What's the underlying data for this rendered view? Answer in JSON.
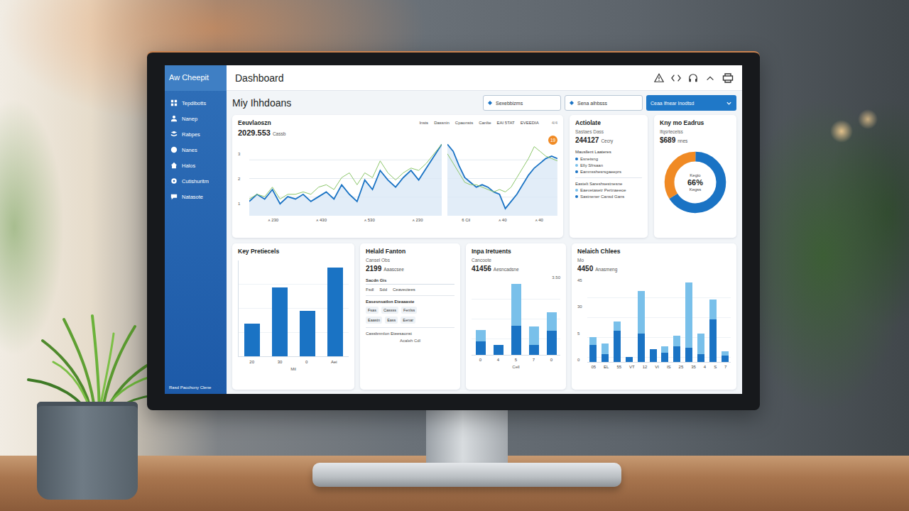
{
  "sidebar": {
    "brand": "Aw Cheepit",
    "items": [
      "Tepdlbotts",
      "Nanep",
      "Rabpes",
      "Nanes",
      "Halos",
      "Cutishuritm",
      "Natasote"
    ],
    "footer": "Rasd Pacchony Clene"
  },
  "topbar": {
    "title": "Dashboard"
  },
  "header": {
    "heading": "Miy Ihhdoans",
    "filters": [
      "Sexebbizms",
      "Sena alhbsss"
    ],
    "dropdown": "Ceaa Ifnear Inodtsd"
  },
  "trend": {
    "title": "Eeuvlaoszn",
    "tabs": [
      "Insts",
      "Dassnin",
      "Cpaonsts",
      "Canlte",
      "EAI 5TAT",
      "EVEEDIA"
    ],
    "corner": "4/4",
    "value": "2029.553",
    "unit": "Cassb",
    "y_ticks": [
      "3",
      "2",
      "1"
    ],
    "badge": "19",
    "charts": [
      {
        "x_labels": [
          "ᴀ 230",
          "ᴀ 430",
          "ᴀ 530",
          "ᴀ 230"
        ],
        "series": [
          {
            "values": [
              0.6,
              0.9,
              0.7,
              1.1,
              0.5,
              0.8,
              0.7,
              0.9,
              0.6,
              0.8,
              1.0,
              0.7,
              1.3,
              0.9,
              0.6,
              1.5,
              1.1,
              1.9,
              1.5,
              1.2,
              1.6,
              1.9,
              1.5,
              2.0,
              2.5,
              3.0
            ],
            "color": "#1a73c4"
          },
          {
            "values": [
              0.7,
              0.9,
              0.8,
              1.2,
              0.7,
              0.9,
              0.9,
              1.0,
              0.9,
              1.2,
              1.3,
              1.1,
              1.6,
              1.8,
              1.3,
              1.8,
              1.6,
              2.3,
              1.8,
              1.5,
              1.8,
              2.0,
              1.9,
              2.2,
              2.6,
              3.0
            ],
            "color": "#8cc66a"
          }
        ]
      },
      {
        "x_labels": [
          "6 Cil",
          "ᴀ 40",
          "ᴀ 40"
        ],
        "series": [
          {
            "values": [
              3.0,
              2.7,
              2.1,
              1.6,
              1.4,
              1.2,
              1.3,
              1.2,
              1.0,
              0.9,
              0.3,
              0.6,
              0.9,
              1.3,
              1.7,
              2.0,
              2.2,
              2.4,
              2.5,
              2.4
            ],
            "color": "#1a73c4"
          },
          {
            "values": [
              2.6,
              2.2,
              1.8,
              1.4,
              1.3,
              1.3,
              1.2,
              1.1,
              1.0,
              1.1,
              1.0,
              1.2,
              1.6,
              2.0,
              2.4,
              2.9,
              2.7,
              2.5,
              2.4,
              2.3
            ],
            "color": "#8cc66a"
          }
        ]
      }
    ]
  },
  "activity": {
    "title": "Actiolate",
    "subtitle": "Sastaes Dass",
    "value": "244127",
    "unit": "Cecry",
    "section": "Mausllent Laateres",
    "legend": [
      {
        "label": "Esnetsng",
        "color": "#1a73c4"
      },
      {
        "label": "Elly Sfrsaan",
        "color": "#79c0ea"
      },
      {
        "label": "Eamnsshesrsgaeeprs",
        "color": "#1a73c4"
      }
    ],
    "section2": "Eastelt Sareshsestnesne",
    "rows": [
      {
        "label": "Eaevetasetr Pertnaeeoe",
        "color": "#79c0ea"
      },
      {
        "label": "Sastnener Cansd Gans",
        "color": "#1a73c4"
      }
    ]
  },
  "donut": {
    "title": "Kny mo Eadrus",
    "sub": "Ifqsrtecelss",
    "value": "$689",
    "unit": "nnes",
    "center_top": "Kegio",
    "center_value": "66%",
    "center_bottom": "Kegss",
    "segments": [
      {
        "value": 66,
        "color": "#1a73c4"
      },
      {
        "value": 34,
        "color": "#f08a24"
      }
    ]
  },
  "key": {
    "title": "Key Pretiecels",
    "bars": [
      {
        "label": "20",
        "value": 45
      },
      {
        "label": "30",
        "value": 95
      },
      {
        "label": "0",
        "value": 62
      },
      {
        "label": "Aei",
        "value": 122
      }
    ],
    "footer": "Mil"
  },
  "helald": {
    "title": "Helald Fanton",
    "sub": "Cansel Obs",
    "value": "2199",
    "unit": "Aaascsee",
    "section": "Sacdn Gis",
    "cols": [
      "Fsdl",
      "Sdd",
      "Ceavectees"
    ],
    "section2": "Easesnsatlon Eteaaaste",
    "chips": [
      [
        "Fsas",
        "Cassss",
        "Fenlss"
      ],
      [
        "Eaastn",
        "Eass",
        "Eenar"
      ]
    ],
    "footer": "Cassbnmlon Eteesaonst",
    "caption": "Acaleh Cdl"
  },
  "inpa": {
    "title": "Inpa Iretuents",
    "sub": "Cancoote",
    "value": "41456",
    "unit": "Aesncadsne",
    "top_label": "3.50",
    "groups": [
      {
        "label": "0",
        "values": [
          25,
          22
        ]
      },
      {
        "label": "4",
        "values": [
          18,
          0
        ]
      },
      {
        "label": "5",
        "values": [
          55,
          78
        ]
      },
      {
        "label": "7",
        "values": [
          18,
          35
        ]
      },
      {
        "label": "0",
        "values": [
          45,
          35
        ]
      }
    ],
    "footer": "Cell"
  },
  "nelaich": {
    "title": "Nelaich Chlees",
    "sub": "Mo",
    "value": "4450",
    "unit": "Anasmeng",
    "y_ticks": [
      "45",
      "30",
      "5",
      "0"
    ],
    "groups": [
      {
        "label": "05",
        "values": [
          22,
          10
        ]
      },
      {
        "label": "EL",
        "values": [
          10,
          14
        ]
      },
      {
        "label": "55",
        "values": [
          40,
          12
        ]
      },
      {
        "label": "VT",
        "values": [
          6,
          0
        ]
      },
      {
        "label": "12",
        "values": [
          36,
          55
        ]
      },
      {
        "label": "VI",
        "values": [
          16,
          0
        ]
      },
      {
        "label": "IS",
        "values": [
          12,
          8
        ]
      },
      {
        "label": "25",
        "values": [
          20,
          14
        ]
      },
      {
        "label": "35",
        "values": [
          18,
          84
        ]
      },
      {
        "label": "4",
        "values": [
          10,
          26
        ]
      },
      {
        "label": "S",
        "values": [
          55,
          25
        ]
      },
      {
        "label": "7",
        "values": [
          8,
          6
        ]
      }
    ]
  }
}
